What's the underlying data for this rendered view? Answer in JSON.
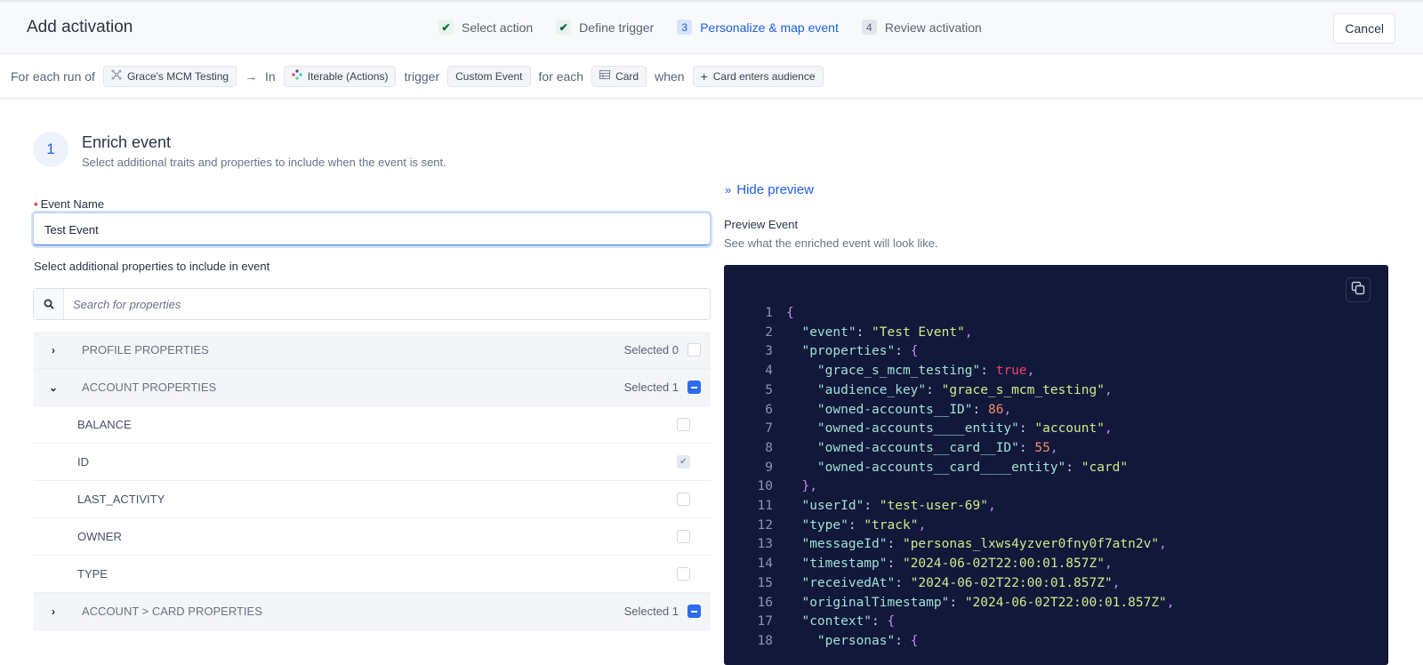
{
  "header": {
    "title": "Add activation",
    "steps": [
      {
        "badge": "✔",
        "label": "Select action",
        "state": "done"
      },
      {
        "badge": "✔",
        "label": "Define trigger",
        "state": "done"
      },
      {
        "badge": "3",
        "label": "Personalize & map event",
        "state": "current"
      },
      {
        "badge": "4",
        "label": "Review activation",
        "state": "todo"
      }
    ],
    "cancel_label": "Cancel"
  },
  "trigger_bar": {
    "for_each_run_of": "For each run of",
    "audience_chip": "Grace's MCM Testing",
    "arrow": "→",
    "in": "In",
    "destination_chip": "Iterable (Actions)",
    "trigger": "trigger",
    "action_chip": "Custom Event",
    "for_each": "for each",
    "entity_chip": "Card",
    "when": "when",
    "condition_chip": "Card enters audience"
  },
  "section": {
    "number": "1",
    "title": "Enrich event",
    "subtitle": "Select additional traits and properties to include when the event is sent."
  },
  "event_name": {
    "label": "Event Name",
    "required_marker": "•",
    "value": "Test Event"
  },
  "properties": {
    "label": "Select additional properties to include in event",
    "search_placeholder": "Search for properties",
    "groups": [
      {
        "label": "PROFILE PROPERTIES",
        "selected": "Selected 0",
        "expanded": false
      },
      {
        "label": "ACCOUNT PROPERTIES",
        "selected": "Selected 1",
        "expanded": true,
        "items": [
          {
            "label": "BALANCE",
            "checked": false
          },
          {
            "label": "ID",
            "checked": true
          },
          {
            "label": "LAST_ACTIVITY",
            "checked": false
          },
          {
            "label": "OWNER",
            "checked": false
          },
          {
            "label": "TYPE",
            "checked": false
          }
        ]
      },
      {
        "label": "ACCOUNT > CARD PROPERTIES",
        "selected": "Selected 1",
        "expanded": false
      }
    ]
  },
  "preview": {
    "toggle_label": "Hide preview",
    "title": "Preview Event",
    "subtitle": "See what the enriched event will look like.",
    "lines": [
      {
        "n": "1",
        "code": "{"
      },
      {
        "n": "2",
        "code": "  \"event\": \"Test Event\","
      },
      {
        "n": "3",
        "code": "  \"properties\": {"
      },
      {
        "n": "4",
        "code": "    \"grace_s_mcm_testing\": true,"
      },
      {
        "n": "5",
        "code": "    \"audience_key\": \"grace_s_mcm_testing\","
      },
      {
        "n": "6",
        "code": "    \"owned-accounts__ID\": 86,"
      },
      {
        "n": "7",
        "code": "    \"owned-accounts____entity\": \"account\","
      },
      {
        "n": "8",
        "code": "    \"owned-accounts__card__ID\": 55,"
      },
      {
        "n": "9",
        "code": "    \"owned-accounts__card____entity\": \"card\""
      },
      {
        "n": "10",
        "code": "  },"
      },
      {
        "n": "11",
        "code": "  \"userId\": \"test-user-69\","
      },
      {
        "n": "12",
        "code": "  \"type\": \"track\","
      },
      {
        "n": "13",
        "code": "  \"messageId\": \"personas_lxws4yzver0fny0f7atn2v\","
      },
      {
        "n": "14",
        "code": "  \"timestamp\": \"2024-06-02T22:00:01.857Z\","
      },
      {
        "n": "15",
        "code": "  \"receivedAt\": \"2024-06-02T22:00:01.857Z\","
      },
      {
        "n": "16",
        "code": "  \"originalTimestamp\": \"2024-06-02T22:00:01.857Z\","
      },
      {
        "n": "17",
        "code": "  \"context\": {"
      },
      {
        "n": "18",
        "code": "    \"personas\": {"
      }
    ]
  },
  "colors": {
    "accent": "#1f5fdb",
    "checkbox_active": "#2f6bf0",
    "code_bg": "#12183a",
    "required": "#e0334f"
  }
}
